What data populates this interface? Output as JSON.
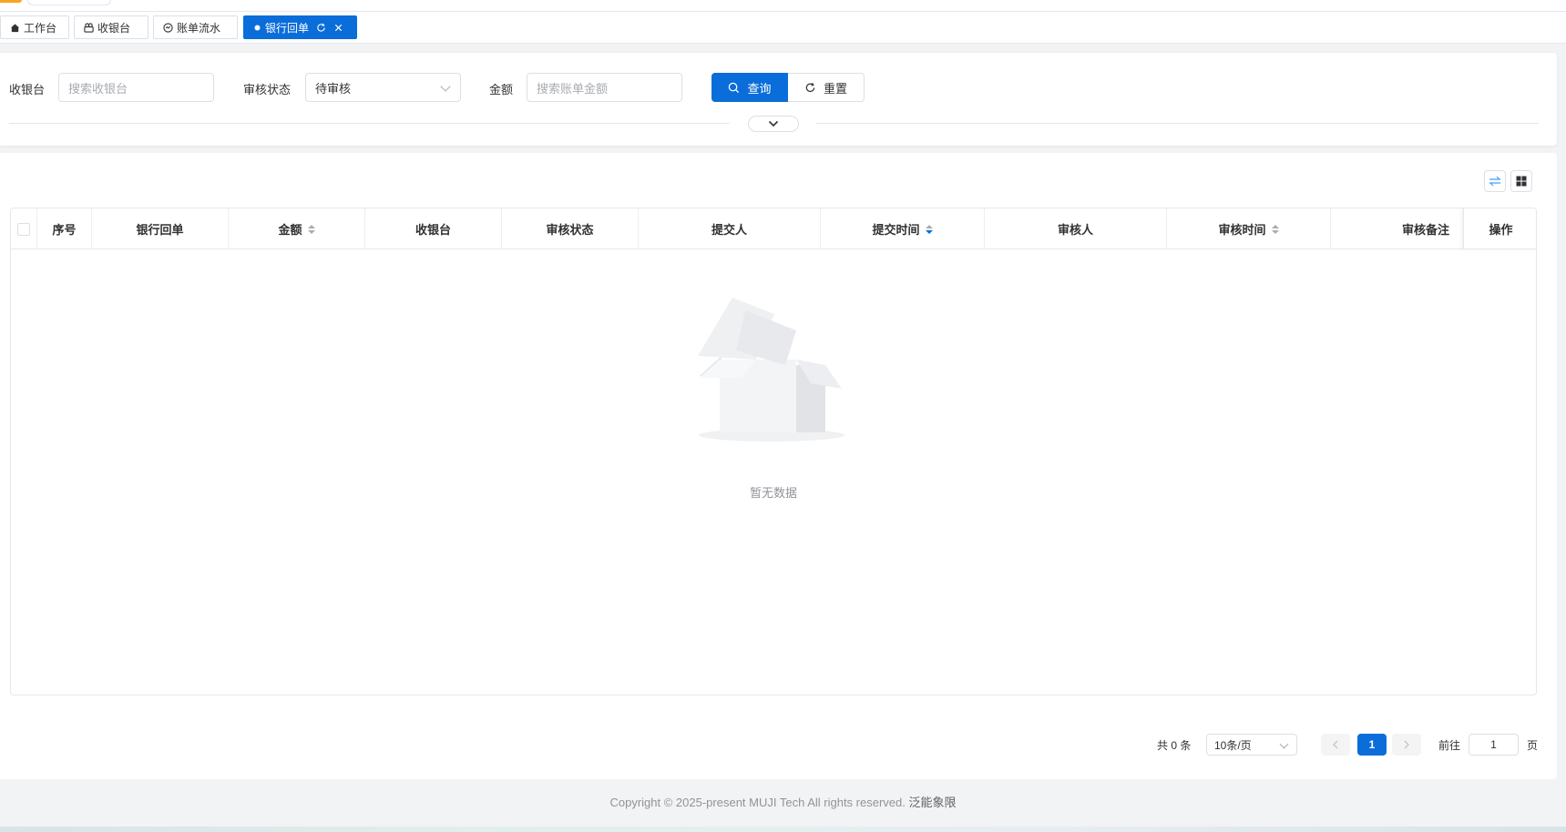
{
  "tabs": [
    {
      "label": "工作台",
      "icon": "home-icon"
    },
    {
      "label": "收银台",
      "icon": "cashier-icon"
    },
    {
      "label": "账单流水",
      "icon": "bill-icon"
    },
    {
      "label": "银行回单",
      "icon": "dot-icon",
      "active": true
    }
  ],
  "search": {
    "cashier_label": "收银台",
    "cashier_placeholder": "搜索收银台",
    "status_label": "审核状态",
    "status_value": "待审核",
    "amount_label": "金额",
    "amount_placeholder": "搜索账单金额",
    "query_label": "查询",
    "reset_label": "重置"
  },
  "table": {
    "columns": [
      "序号",
      "银行回单",
      "金额",
      "收银台",
      "审核状态",
      "提交人",
      "提交时间",
      "审核人",
      "审核时间",
      "审核备注",
      "操作"
    ],
    "rows": [],
    "empty_text": "暂无数据"
  },
  "pagination": {
    "total_text": "共 0 条",
    "page_size": "10条/页",
    "current_page": "1",
    "goto_label": "前往",
    "goto_value": "1",
    "page_suffix": "页"
  },
  "footer": {
    "copyright": "Copyright © 2025-present MUJI Tech All rights reserved.",
    "brand": "泛能象限"
  },
  "colors": {
    "primary": "#0a6dd9",
    "border": "#dcdfe6",
    "muted_text": "#909399"
  }
}
